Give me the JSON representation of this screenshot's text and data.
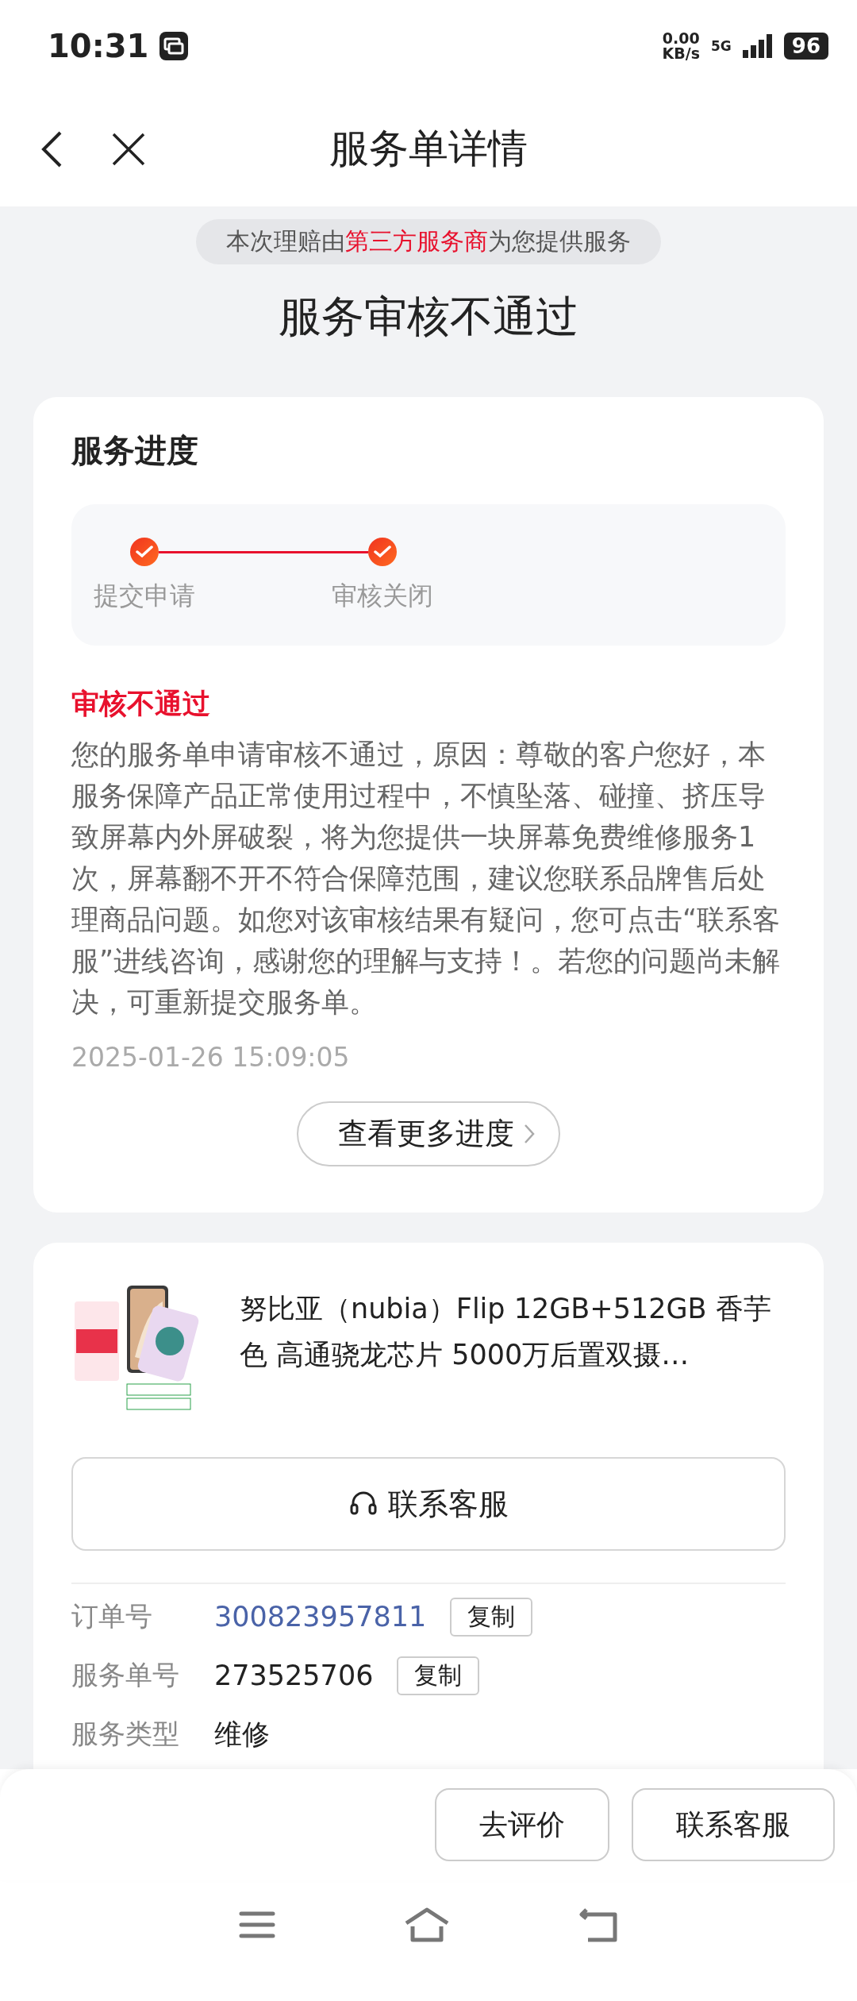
{
  "status_bar": {
    "time": "10:31",
    "net_speed": "0.00",
    "net_unit": "KB/s",
    "network": "5G",
    "battery": "96"
  },
  "header": {
    "title": "服务单详情"
  },
  "notice": "本次理赔由**第三方服务商**为您提供服务",
  "status_title": "服务审核不通过",
  "progress_card": {
    "title": "服务进度",
    "steps": [
      {
        "label": "提交申请",
        "done": true
      },
      {
        "label": "审核关闭",
        "done": true
      }
    ],
    "result_title": "审核不通过",
    "result_text": "您的服务单申请审核不通过，原因：尊敬的客户您好，本服务保障产品正常使用过程中，不慎坠落、碰撞、挤压导致屏幕内外屏破裂，将为您提供一块屏幕免费维修服务1次，屏幕翻不开不符合保障范围，建议您联系品牌售后处理商品问题。如您对该审核结果有疑问，您可点击“联系客服”进线咨询，感谢您的理解与支持！。若您的问题尚未解决，可重新提交服务单。",
    "time": "2025-01-26 15:09:05",
    "more_button": "查看更多进度"
  },
  "order_card": {
    "product": {
      "kind": "picture",
      "title": "努比亚（nubia）Flip 12GB+512GB 香芋色 高通骁龙芯片 5000万后置双摄…"
    },
    "contact_button": "联系客服",
    "rows": [
      {
        "label": "订单号",
        "value": "300823957811",
        "link": true,
        "copy": "复制"
      },
      {
        "label": "服务单号",
        "value": "273525706",
        "link": false,
        "copy": "复制"
      },
      {
        "label": "服务类型",
        "value": "维修",
        "link": false
      }
    ]
  },
  "actions": [
    {
      "label": "去评价"
    },
    {
      "label": "联系客服"
    }
  ]
}
